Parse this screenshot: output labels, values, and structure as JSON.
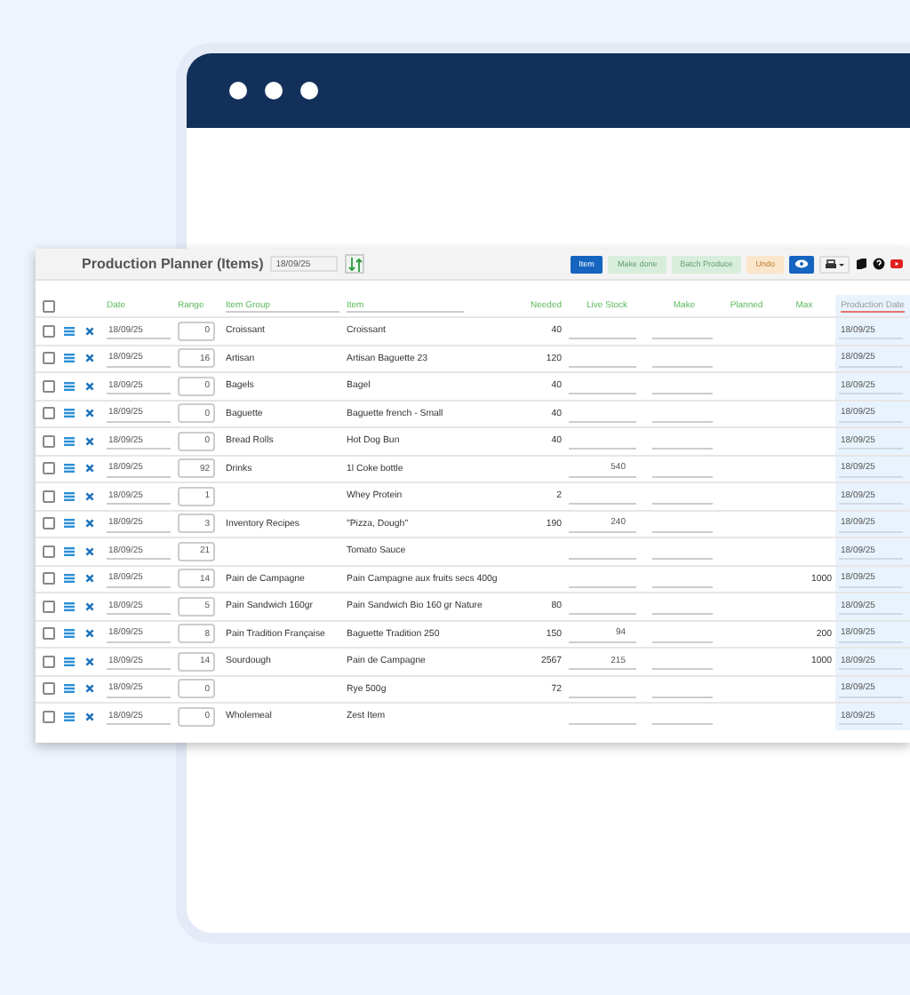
{
  "planner": {
    "title": "Production Planner (Items)",
    "date": "18/09/25"
  },
  "toolbar": [
    {
      "label": "Item",
      "kind": "primary",
      "disabled": false
    },
    {
      "label": "Make done",
      "kind": "green",
      "disabled": true
    },
    {
      "label": "Batch Produce",
      "kind": "green",
      "disabled": true
    },
    {
      "label": "Undo",
      "kind": "orange",
      "disabled": true
    }
  ],
  "select_all": {
    "checked": false
  },
  "columns": [
    "Date",
    "Range",
    "Item Group",
    "Item",
    "Needed",
    "Live Stock",
    "Make",
    "Planned",
    "Max",
    "Production Date"
  ],
  "rows": [
    {
      "checked": false,
      "date": "18/09/25",
      "range": "0",
      "group": "Croissant",
      "item": "Croissant",
      "needed": "40",
      "live_stock": "",
      "max": "",
      "production_date": "18/09/25"
    },
    {
      "checked": false,
      "date": "18/09/25",
      "range": "16",
      "group": "Artisan",
      "item": "Artisan Baguette 23",
      "needed": "120",
      "live_stock": "",
      "max": "",
      "production_date": "18/09/25"
    },
    {
      "checked": false,
      "date": "18/09/25",
      "range": "0",
      "group": "Bagels",
      "item": "Bagel",
      "needed": "40",
      "live_stock": "",
      "max": "",
      "production_date": "18/09/25"
    },
    {
      "checked": false,
      "date": "18/09/25",
      "range": "0",
      "group": "Baguette",
      "item": "Baguette french - Small",
      "needed": "40",
      "live_stock": "",
      "max": "",
      "production_date": "18/09/25"
    },
    {
      "checked": false,
      "date": "18/09/25",
      "range": "0",
      "group": "Bread Rolls",
      "item": "Hot Dog Bun",
      "needed": "40",
      "live_stock": "",
      "max": "",
      "production_date": "18/09/25"
    },
    {
      "checked": false,
      "date": "18/09/25",
      "range": "92",
      "group": "Drinks",
      "item": "1l Coke bottle",
      "needed": "",
      "live_stock": "540",
      "max": "",
      "production_date": "18/09/25"
    },
    {
      "checked": false,
      "date": "18/09/25",
      "range": "1",
      "group": "",
      "item": "Whey Protein",
      "needed": "2",
      "live_stock": "",
      "max": "",
      "production_date": "18/09/25"
    },
    {
      "checked": false,
      "date": "18/09/25",
      "range": "3",
      "group": "Inventory Recipes",
      "item": "\"Pizza, Dough\"",
      "needed": "190",
      "live_stock": "240",
      "max": "",
      "production_date": "18/09/25"
    },
    {
      "checked": false,
      "date": "18/09/25",
      "range": "21",
      "group": "",
      "item": "Tomato Sauce",
      "needed": "",
      "live_stock": "",
      "max": "",
      "production_date": "18/09/25"
    },
    {
      "checked": false,
      "date": "18/09/25",
      "range": "14",
      "group": "Pain de Campagne",
      "item": "Pain Campagne aux fruits secs 400g",
      "needed": "",
      "live_stock": "",
      "max": "1000",
      "production_date": "18/09/25"
    },
    {
      "checked": false,
      "date": "18/09/25",
      "range": "5",
      "group": "Pain Sandwich 160gr",
      "item": "Pain Sandwich Bio 160 gr Nature",
      "needed": "80",
      "live_stock": "",
      "max": "",
      "production_date": "18/09/25"
    },
    {
      "checked": false,
      "date": "18/09/25",
      "range": "8",
      "group": "Pain Tradition Française",
      "item": "Baguette Tradition 250",
      "needed": "150",
      "live_stock": "94",
      "max": "200",
      "production_date": "18/09/25"
    },
    {
      "checked": false,
      "date": "18/09/25",
      "range": "14",
      "group": "Sourdough",
      "item": "Pain de Campagne",
      "needed": "2567",
      "live_stock": "215",
      "max": "1000",
      "production_date": "18/09/25"
    },
    {
      "checked": false,
      "date": "18/09/25",
      "range": "0",
      "group": "",
      "item": "Rye 500g",
      "needed": "72",
      "live_stock": "",
      "max": "",
      "production_date": "18/09/25"
    },
    {
      "checked": false,
      "date": "18/09/25",
      "range": "0",
      "group": "Wholemeal",
      "item": "Zest Item",
      "needed": "",
      "live_stock": "",
      "max": "",
      "production_date": "18/09/25"
    }
  ]
}
